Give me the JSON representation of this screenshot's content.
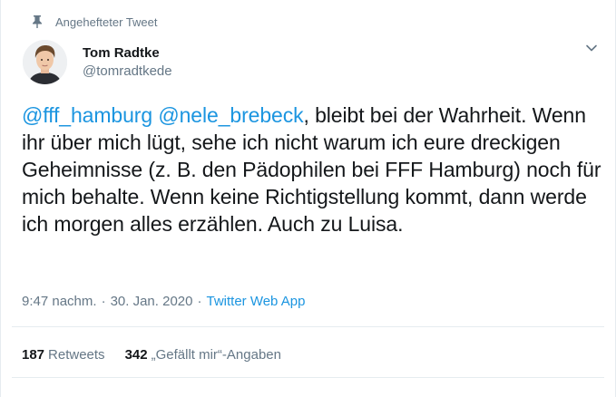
{
  "pinned": {
    "label": "Angehefteter Tweet",
    "icon": "pin-icon"
  },
  "author": {
    "name": "Tom Radtke",
    "handle": "@tomradtkede",
    "avatar_icon": "avatar"
  },
  "menu": {
    "icon": "chevron-down-icon"
  },
  "tweet": {
    "mention1": "@fff_hamburg",
    "mention2": "@nele_brebeck",
    "text_line1_rest": ", bleibt bei der Wahrheit.",
    "text_rest": "Wenn ihr über mich lügt, sehe ich nicht warum ich eure dreckigen Geheimnisse (z. B. den Pädophilen bei FFF Hamburg) noch für mich behalte. Wenn keine Richtigstellung kommt, dann werde ich morgen alles erzählen. Auch zu Luisa."
  },
  "meta": {
    "time": "9:47 nachm.",
    "date": "30. Jan. 2020",
    "source": "Twitter Web App",
    "separator": "·"
  },
  "stats": {
    "retweets_count": "187",
    "retweets_label": "Retweets",
    "likes_count": "342",
    "likes_label": "„Gefällt mir“-Angaben"
  },
  "colors": {
    "link": "#1b95e0",
    "secondary_text": "#657786",
    "primary_text": "#14171a",
    "border": "#e6ecf0"
  }
}
